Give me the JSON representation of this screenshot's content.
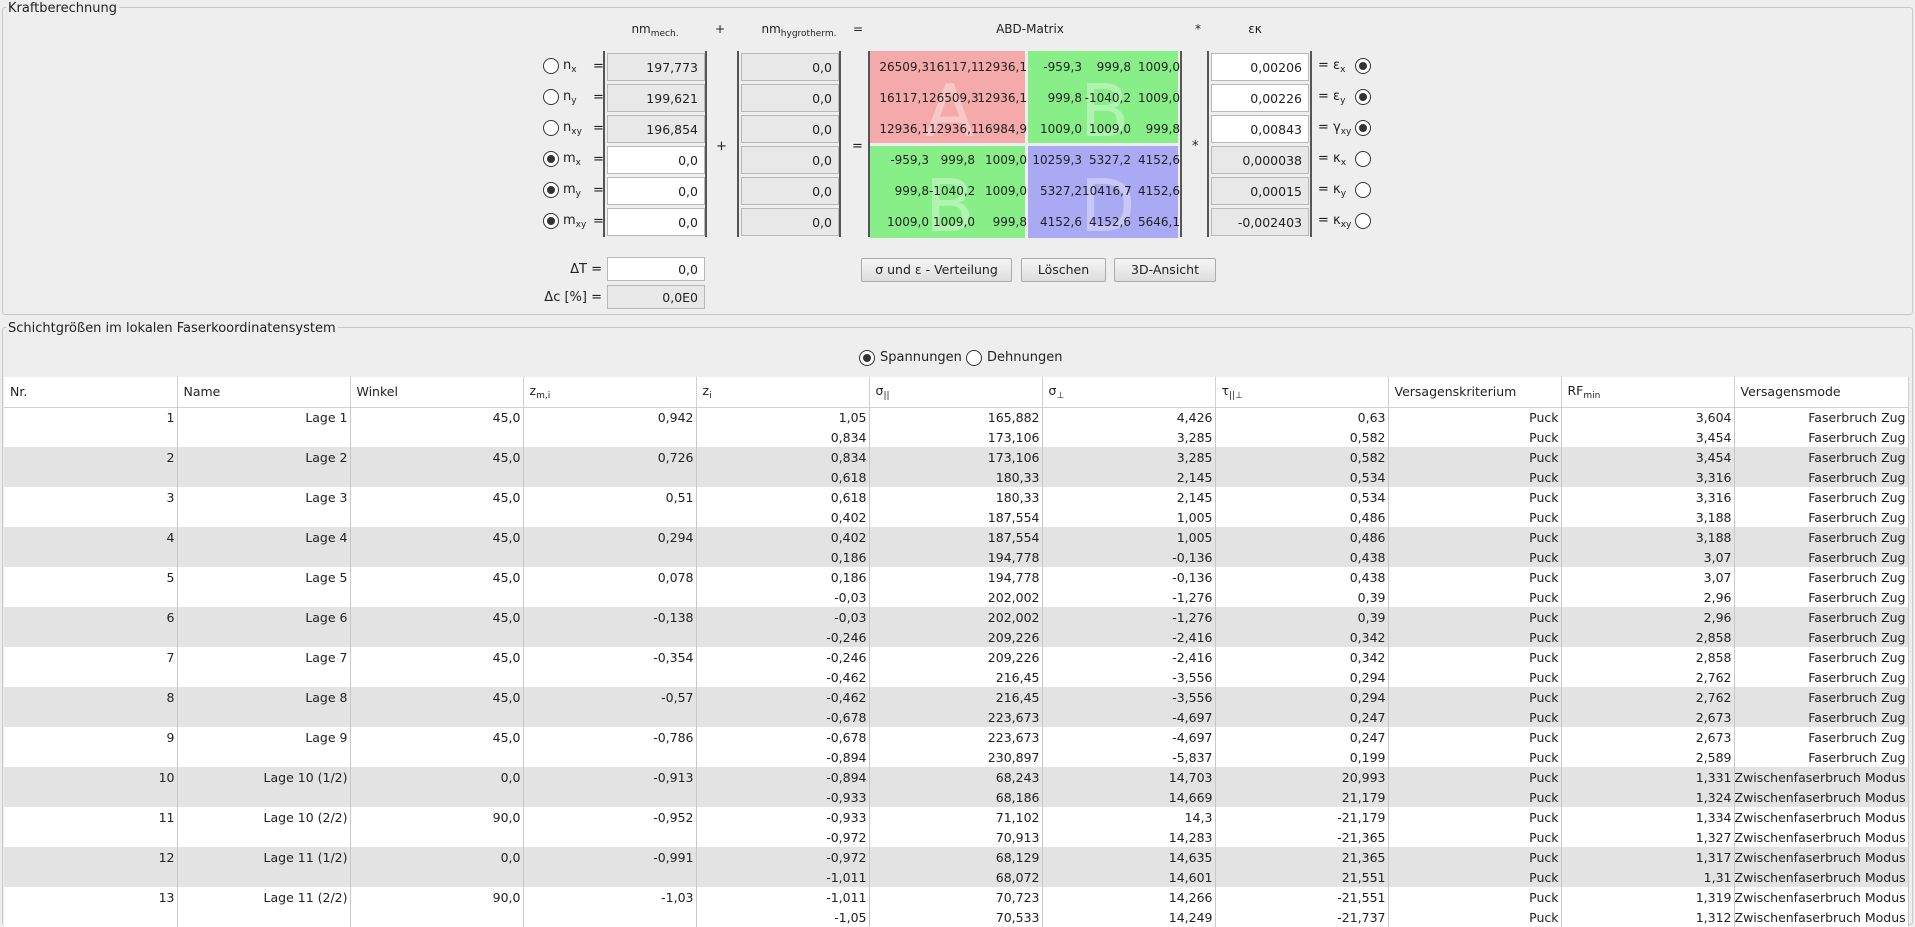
{
  "force_section": {
    "title": "Kraftberechnung",
    "headers": {
      "nm_mech": "nm",
      "nm_mech_sub": "mech.",
      "plus": "+",
      "nm_hygro": "nm",
      "nm_hygro_sub": "hygrotherm.",
      "equals": "=",
      "abd": "ABD-Matrix",
      "times": "*",
      "eps_kappa": "εκ"
    },
    "rows": [
      {
        "label": "n",
        "sub": "x",
        "selected": false,
        "mech": "197,773",
        "hygro": "0,0",
        "result": "0,00206",
        "rlabel": "= ε",
        "rsub": "x",
        "rselected": true
      },
      {
        "label": "n",
        "sub": "y",
        "selected": false,
        "mech": "199,621",
        "hygro": "0,0",
        "result": "0,00226",
        "rlabel": "= ε",
        "rsub": "y",
        "rselected": true
      },
      {
        "label": "n",
        "sub": "xy",
        "selected": false,
        "mech": "196,854",
        "hygro": "0,0",
        "result": "0,00843",
        "rlabel": "= γ",
        "rsub": "xy",
        "rselected": true
      },
      {
        "label": "m",
        "sub": "x",
        "selected": true,
        "mech": "0,0",
        "hygro": "0,0",
        "result": "0,000038",
        "rlabel": "= κ",
        "rsub": "x",
        "rselected": false
      },
      {
        "label": "m",
        "sub": "y",
        "selected": true,
        "mech": "0,0",
        "hygro": "0,0",
        "result": "0,00015",
        "rlabel": "= κ",
        "rsub": "y",
        "rselected": false
      },
      {
        "label": "m",
        "sub": "xy",
        "selected": true,
        "mech": "0,0",
        "hygro": "0,0",
        "result": "-0,002403",
        "rlabel": "= κ",
        "rsub": "xy",
        "rselected": false
      }
    ],
    "matrix": [
      [
        "26509,3",
        "16117,1",
        "12936,1",
        "-959,3",
        "999,8",
        "1009,0"
      ],
      [
        "16117,1",
        "26509,3",
        "12936,1",
        "999,8",
        "-1040,2",
        "1009,0"
      ],
      [
        "12936,1",
        "12936,1",
        "16984,9",
        "1009,0",
        "1009,0",
        "999,8"
      ],
      [
        "-959,3",
        "999,8",
        "1009,0",
        "10259,3",
        "5327,2",
        "4152,6"
      ],
      [
        "999,8",
        "-1040,2",
        "1009,0",
        "5327,2",
        "10416,7",
        "4152,6"
      ],
      [
        "1009,0",
        "1009,0",
        "999,8",
        "4152,6",
        "4152,6",
        "5646,1"
      ]
    ],
    "quadrant_letters": {
      "a": "A",
      "b1": "B",
      "b2": "B",
      "d": "D"
    },
    "delta_t_label": "ΔT =",
    "delta_t_value": "0,0",
    "delta_c_label": "Δc [%] =",
    "delta_c_value": "0,0E0",
    "buttons": {
      "distribution": "σ und ε - Verteilung",
      "clear": "Löschen",
      "view3d": "3D-Ansicht"
    },
    "colors": {
      "a": "#f4aaaa",
      "b": "#88ee88",
      "d": "#aaaaf4"
    }
  },
  "layer_section": {
    "title": "Schichtgrößen im lokalen Faserkoordinatensystem",
    "mode_options": [
      {
        "label": "Spannungen",
        "selected": true
      },
      {
        "label": "Dehnungen",
        "selected": false
      }
    ],
    "columns": [
      {
        "main": "Nr.",
        "sub": ""
      },
      {
        "main": "Name",
        "sub": ""
      },
      {
        "main": "Winkel",
        "sub": ""
      },
      {
        "main": "z",
        "sub": "m,i"
      },
      {
        "main": "z",
        "sub": "i"
      },
      {
        "main": "σ",
        "sub": "||"
      },
      {
        "main": "σ",
        "sub": "⊥"
      },
      {
        "main": "τ",
        "sub": "||⊥"
      },
      {
        "main": "Versagenskriterium",
        "sub": ""
      },
      {
        "main": "RF",
        "sub": "min"
      },
      {
        "main": "Versagensmode",
        "sub": ""
      }
    ],
    "rows": [
      [
        "1",
        "Lage 1",
        "45,0",
        "0,942",
        "1,05",
        "165,882",
        "4,426",
        "0,63",
        "Puck",
        "3,604",
        "Faserbruch Zug"
      ],
      [
        "",
        "",
        "",
        "",
        "0,834",
        "173,106",
        "3,285",
        "0,582",
        "Puck",
        "3,454",
        "Faserbruch Zug"
      ],
      [
        "2",
        "Lage 2",
        "45,0",
        "0,726",
        "0,834",
        "173,106",
        "3,285",
        "0,582",
        "Puck",
        "3,454",
        "Faserbruch Zug"
      ],
      [
        "",
        "",
        "",
        "",
        "0,618",
        "180,33",
        "2,145",
        "0,534",
        "Puck",
        "3,316",
        "Faserbruch Zug"
      ],
      [
        "3",
        "Lage 3",
        "45,0",
        "0,51",
        "0,618",
        "180,33",
        "2,145",
        "0,534",
        "Puck",
        "3,316",
        "Faserbruch Zug"
      ],
      [
        "",
        "",
        "",
        "",
        "0,402",
        "187,554",
        "1,005",
        "0,486",
        "Puck",
        "3,188",
        "Faserbruch Zug"
      ],
      [
        "4",
        "Lage 4",
        "45,0",
        "0,294",
        "0,402",
        "187,554",
        "1,005",
        "0,486",
        "Puck",
        "3,188",
        "Faserbruch Zug"
      ],
      [
        "",
        "",
        "",
        "",
        "0,186",
        "194,778",
        "-0,136",
        "0,438",
        "Puck",
        "3,07",
        "Faserbruch Zug"
      ],
      [
        "5",
        "Lage 5",
        "45,0",
        "0,078",
        "0,186",
        "194,778",
        "-0,136",
        "0,438",
        "Puck",
        "3,07",
        "Faserbruch Zug"
      ],
      [
        "",
        "",
        "",
        "",
        "-0,03",
        "202,002",
        "-1,276",
        "0,39",
        "Puck",
        "2,96",
        "Faserbruch Zug"
      ],
      [
        "6",
        "Lage 6",
        "45,0",
        "-0,138",
        "-0,03",
        "202,002",
        "-1,276",
        "0,39",
        "Puck",
        "2,96",
        "Faserbruch Zug"
      ],
      [
        "",
        "",
        "",
        "",
        "-0,246",
        "209,226",
        "-2,416",
        "0,342",
        "Puck",
        "2,858",
        "Faserbruch Zug"
      ],
      [
        "7",
        "Lage 7",
        "45,0",
        "-0,354",
        "-0,246",
        "209,226",
        "-2,416",
        "0,342",
        "Puck",
        "2,858",
        "Faserbruch Zug"
      ],
      [
        "",
        "",
        "",
        "",
        "-0,462",
        "216,45",
        "-3,556",
        "0,294",
        "Puck",
        "2,762",
        "Faserbruch Zug"
      ],
      [
        "8",
        "Lage 8",
        "45,0",
        "-0,57",
        "-0,462",
        "216,45",
        "-3,556",
        "0,294",
        "Puck",
        "2,762",
        "Faserbruch Zug"
      ],
      [
        "",
        "",
        "",
        "",
        "-0,678",
        "223,673",
        "-4,697",
        "0,247",
        "Puck",
        "2,673",
        "Faserbruch Zug"
      ],
      [
        "9",
        "Lage 9",
        "45,0",
        "-0,786",
        "-0,678",
        "223,673",
        "-4,697",
        "0,247",
        "Puck",
        "2,673",
        "Faserbruch Zug"
      ],
      [
        "",
        "",
        "",
        "",
        "-0,894",
        "230,897",
        "-5,837",
        "0,199",
        "Puck",
        "2,589",
        "Faserbruch Zug"
      ],
      [
        "10",
        "Lage 10 (1/2)",
        "0,0",
        "-0,913",
        "-0,894",
        "68,243",
        "14,703",
        "20,993",
        "Puck",
        "1,331",
        "Zwischenfaserbruch Modus A"
      ],
      [
        "",
        "",
        "",
        "",
        "-0,933",
        "68,186",
        "14,669",
        "21,179",
        "Puck",
        "1,324",
        "Zwischenfaserbruch Modus A"
      ],
      [
        "11",
        "Lage 10 (2/2)",
        "90,0",
        "-0,952",
        "-0,933",
        "71,102",
        "14,3",
        "-21,179",
        "Puck",
        "1,334",
        "Zwischenfaserbruch Modus A"
      ],
      [
        "",
        "",
        "",
        "",
        "-0,972",
        "70,913",
        "14,283",
        "-21,365",
        "Puck",
        "1,327",
        "Zwischenfaserbruch Modus A"
      ],
      [
        "12",
        "Lage 11 (1/2)",
        "0,0",
        "-0,991",
        "-0,972",
        "68,129",
        "14,635",
        "21,365",
        "Puck",
        "1,317",
        "Zwischenfaserbruch Modus A"
      ],
      [
        "",
        "",
        "",
        "",
        "-1,011",
        "68,072",
        "14,601",
        "21,551",
        "Puck",
        "1,31",
        "Zwischenfaserbruch Modus A"
      ],
      [
        "13",
        "Lage 11 (2/2)",
        "90,0",
        "-1,03",
        "-1,011",
        "70,723",
        "14,266",
        "-21,551",
        "Puck",
        "1,319",
        "Zwischenfaserbruch Modus A"
      ],
      [
        "",
        "",
        "",
        "",
        "-1,05",
        "70,533",
        "14,249",
        "-21,737",
        "Puck",
        "1,312",
        "Zwischenfaserbruch Modus A"
      ]
    ]
  }
}
